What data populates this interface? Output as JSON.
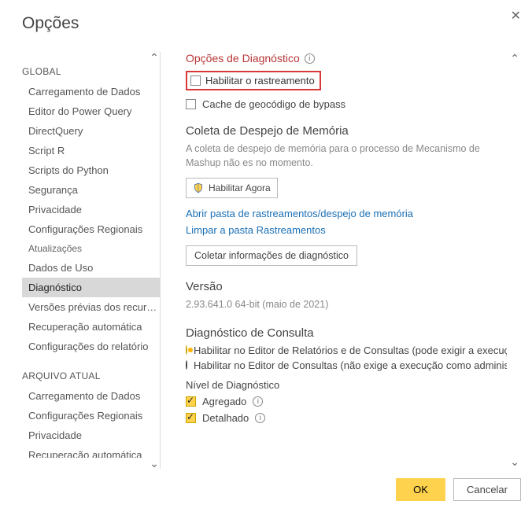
{
  "dialog": {
    "title": "Opções",
    "close_icon": "✕"
  },
  "sidebar": {
    "section_global": "GLOBAL",
    "section_file": "ARQUIVO ATUAL",
    "global_items": [
      "Carregamento de Dados",
      "Editor do Power Query",
      "DirectQuery",
      "Script R",
      "Scripts do Python",
      "Segurança",
      "Privacidade",
      "Configurações Regionais",
      "Atualizações",
      "Dados de Uso",
      "Diagnóstico",
      "Versões prévias dos recursos",
      "Recuperação automática",
      "Configurações do relatório"
    ],
    "file_items": [
      "Carregamento de Dados",
      "Configurações Regionais",
      "Privacidade",
      "Recuperação automática"
    ],
    "selected": "Diagnóstico"
  },
  "content": {
    "diag_title": "Opções de Diagnóstico",
    "chk_trace": "Habilitar o rastreamento",
    "chk_bypass": "Cache de geocódigo de bypass",
    "memdump_title": "Coleta de Despejo de Memória",
    "memdump_desc": "A coleta de despejo de memória para o processo de Mecanismo de Mashup não es no momento.",
    "enable_now_btn": "Habilitar Agora",
    "link_open_folder": "Abrir pasta de rastreamentos/despejo de memória",
    "link_clear_trace": "Limpar a pasta Rastreamentos",
    "collect_btn": "Coletar informações de diagnóstico",
    "version_title": "Versão",
    "version_value": "2.93.641.0 64-bit (maio de 2021)",
    "querydiag_title": "Diagnóstico de Consulta",
    "radio_editor_reports": "Habilitar no Editor de Relatórios e de Consultas (pode exigir a execução co",
    "radio_editor_queries": "Habilitar no Editor de Consultas (não exige a execução como administrador",
    "diaglevel_title": "Nível de Diagnóstico",
    "chk_aggregated": "Agregado",
    "chk_detailed": "Detalhado"
  },
  "footer": {
    "ok": "OK",
    "cancel": "Cancelar"
  }
}
